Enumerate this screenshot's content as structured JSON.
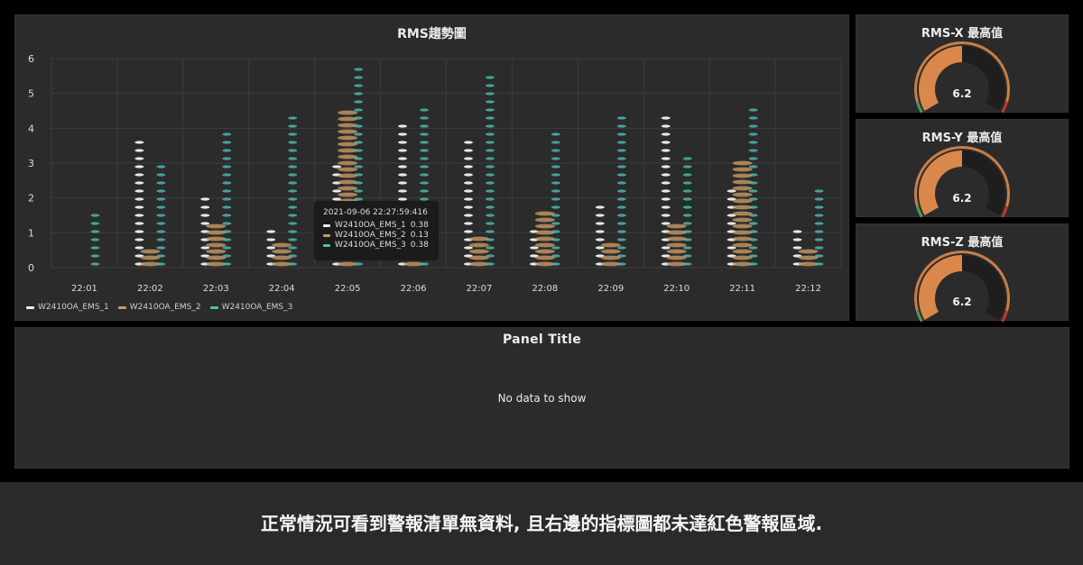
{
  "colors": {
    "series1": "#f2f2f2",
    "series2": "#c89a64",
    "series3": "#4dbfb5",
    "gauge_fill": "#d9874a",
    "gauge_green": "#4a9a5a",
    "gauge_red": "#c0392b",
    "panel_bg": "#2b2b2b"
  },
  "trend_panel": {
    "title": "RMS趨勢圖",
    "tooltip": {
      "time": "2021-09-06 22:27:59:416",
      "rows": [
        {
          "name": "W2410OA_EMS_1",
          "value": "0.38"
        },
        {
          "name": "W2410OA_EMS_2",
          "value": "0.13"
        },
        {
          "name": "W2410OA_EMS_3",
          "value": "0.38"
        }
      ]
    }
  },
  "gauges": [
    {
      "title": "RMS-X 最高值",
      "value": "6.2",
      "fill_fraction": 0.5
    },
    {
      "title": "RMS-Y 最高值",
      "value": "6.2",
      "fill_fraction": 0.5
    },
    {
      "title": "RMS-Z 最高值",
      "value": "6.2",
      "fill_fraction": 0.5
    }
  ],
  "bottom_panel": {
    "title": "Panel  Title",
    "message": "No data to show"
  },
  "caption": "正常情況可看到警報清單無資料, 且右邊的指標圖都未達紅色警報區域.",
  "chart_data": {
    "type": "scatter",
    "title": "RMS趨勢圖",
    "categories": [
      "22:01",
      "22:02",
      "22:03",
      "22:04",
      "22:05",
      "22:06",
      "22:07",
      "22:08",
      "22:09",
      "22:10",
      "22:11",
      "22:12"
    ],
    "y_ticks": [
      "0",
      "1",
      "2",
      "3",
      "4",
      "5",
      "6"
    ],
    "ylim": [
      0,
      6
    ],
    "grid": true,
    "legend_position": "bottom-left",
    "series": [
      {
        "name": "W2410OA_EMS_1",
        "max_values": [
          0,
          3.6,
          2.1,
          1.1,
          3.1,
          4.2,
          3.7,
          1.1,
          1.8,
          4.4,
          2.4,
          1.1
        ]
      },
      {
        "name": "W2410OA_EMS_2",
        "max_values": [
          0,
          0.5,
          1.3,
          0.8,
          4.6,
          1.4,
          0.9,
          1.6,
          0.7,
          1.3,
          3.1,
          0.6
        ]
      },
      {
        "name": "W2410OA_EMS_3",
        "max_values": [
          1.6,
          3.1,
          4.0,
          4.3,
          5.7,
          4.7,
          5.6,
          4.0,
          4.4,
          3.3,
          4.6,
          2.2
        ]
      }
    ]
  }
}
